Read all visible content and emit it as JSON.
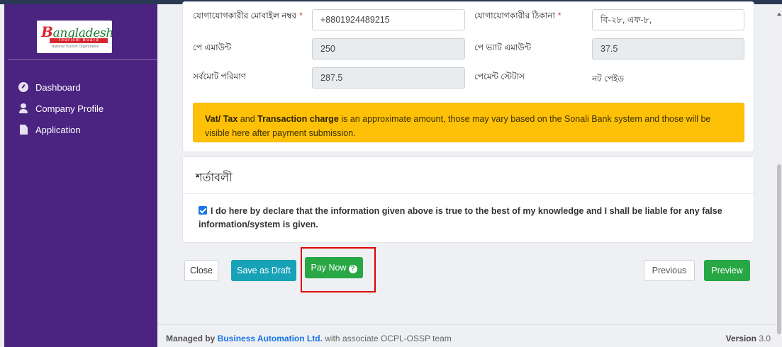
{
  "sidebar": {
    "logo": {
      "word_cap": "B",
      "word_rest": "angladesh",
      "strip": "Tourism Board",
      "sub": "National Tourism Organization"
    },
    "items": [
      {
        "label": "Dashboard",
        "icon": "dashboard-icon"
      },
      {
        "label": "Company Profile",
        "icon": "user-icon"
      },
      {
        "label": "Application",
        "icon": "file-icon"
      }
    ]
  },
  "form": {
    "contact_mobile_label": "যোগাযোগকারীর মোবাইল নম্বর",
    "contact_mobile_value": "+8801924489215",
    "contact_address_label": "যোগাযোগকারীর ঠিকানা",
    "contact_address_value": "বি-২৮, এফ-৮,",
    "pay_amount_label": "পে এমাউন্ট",
    "pay_amount_value": "250",
    "pay_vat_label": "পে ভ্যাট এমাউন্ট",
    "pay_vat_value": "37.5",
    "total_label": "সর্বমোট পরিমাণ",
    "total_value": "287.5",
    "payment_status_label": "পেমেন্ট স্টেটাস",
    "payment_status_value": "নট পেইড",
    "required_mark": "*"
  },
  "alert": {
    "bold1": "Vat/ Tax",
    "text1": " and ",
    "bold2": "Transaction charge",
    "text2": " is an approximate amount, those may vary based on the Sonali Bank system and those will be visible here after payment submission."
  },
  "terms": {
    "title": "শর্তাবলী",
    "declaration": "I do here by declare that the information given above is true to the best of my knowledge and I shall be liable for any false information/system is given.",
    "checked": true
  },
  "actions": {
    "close": "Close",
    "save_draft": "Save as Draft",
    "pay_now": "Pay Now",
    "previous": "Previous",
    "preview": "Preview"
  },
  "footer": {
    "prefix": "Managed by ",
    "brand": "Business Automation Ltd.",
    "suffix": " with associate OCPL-OSSP team",
    "version_label": "Version",
    "version_value": "3.0"
  },
  "colors": {
    "sidebar": "#4b2380",
    "alert": "#ffc107",
    "success": "#28a745",
    "info": "#17a2b8",
    "highlight": "#e00000"
  }
}
